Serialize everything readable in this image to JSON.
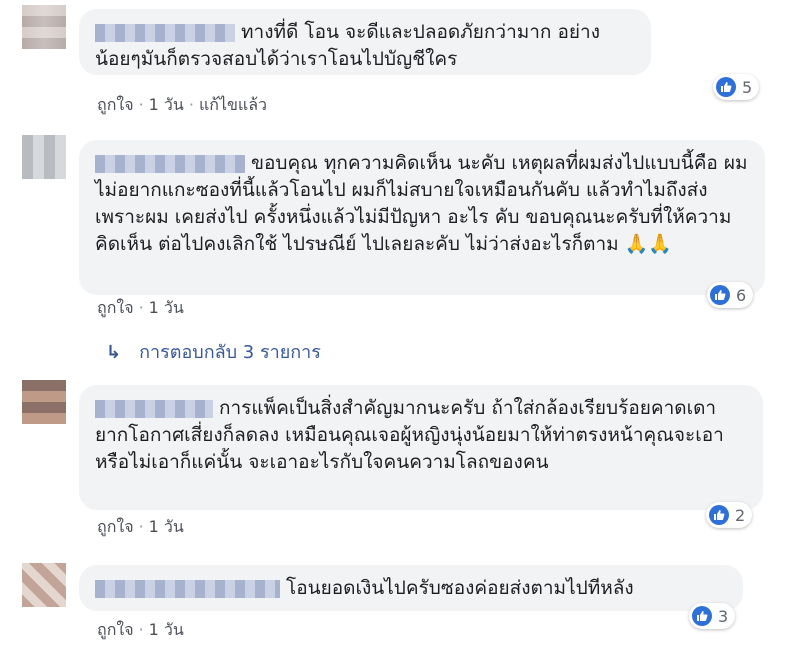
{
  "comments": [
    {
      "text": "ทางที่ดี โอน จะดีและปลอดภัยกว่ามาก อย่างน้อยๆมันก็ตรวจสอบได้ว่าเราโอนไปบัญชีใคร",
      "like_label": "ถูกใจ",
      "time": "1 วัน",
      "edited": "แก้ไขแล้ว",
      "reaction_count": "5"
    },
    {
      "text": "ขอบคุณ ทุกความคิดเห็น นะคับ เหตุผลที่ผมส่งไปแบบนี้คือ ผมไม่อยากแกะซองที่นี้แล้วโอนไป ผมก็ไม่สบายใจเหมือนกันคับ แล้วทำไมถึงส่ง เพราะผม เคยส่งไป ครั้งหนึ่งแล้วไม่มีปัญหา อะไร คับ ขอบคุณนะครับที่ให้ความคิดเห็น ต่อไปคงเลิกใช้ ไปรษณีย์ ไปเลยละคับ ไม่ว่าส่งอะไรก็ตาม 🙏🙏",
      "like_label": "ถูกใจ",
      "time": "1 วัน",
      "reaction_count": "6",
      "replies_label": "การตอบกลับ 3 รายการ"
    },
    {
      "text": "การแพ็คเป็นสิ่งสำคัญมากนะครับ ถ้าใส่กล้องเรียบร้อยคาดเดายากโอกาศเสี่ยงก็ลดลง เหมือนคุณเจอผู้หญิงนุ่งน้อยมาให้ท่าตรงหน้าคุณจะเอาหรือไม่เอาก็แค่นั้น จะเอาอะไรกับใจคนความโลถของคน",
      "like_label": "ถูกใจ",
      "time": "1 วัน",
      "reaction_count": "2"
    },
    {
      "text": "โอนยอดเงินไปครับซองค่อยส่งตามไปทีหลัง",
      "like_label": "ถูกใจ",
      "time": "1 วัน",
      "reaction_count": "3"
    }
  ],
  "colors": {
    "bubble": "#f2f3f5",
    "link": "#385898",
    "like_icon": "#2f6fd8"
  },
  "icons": {
    "reaction": "thumbs-up-icon",
    "reply_arrow": "reply-arrow-icon"
  },
  "separator": "·"
}
